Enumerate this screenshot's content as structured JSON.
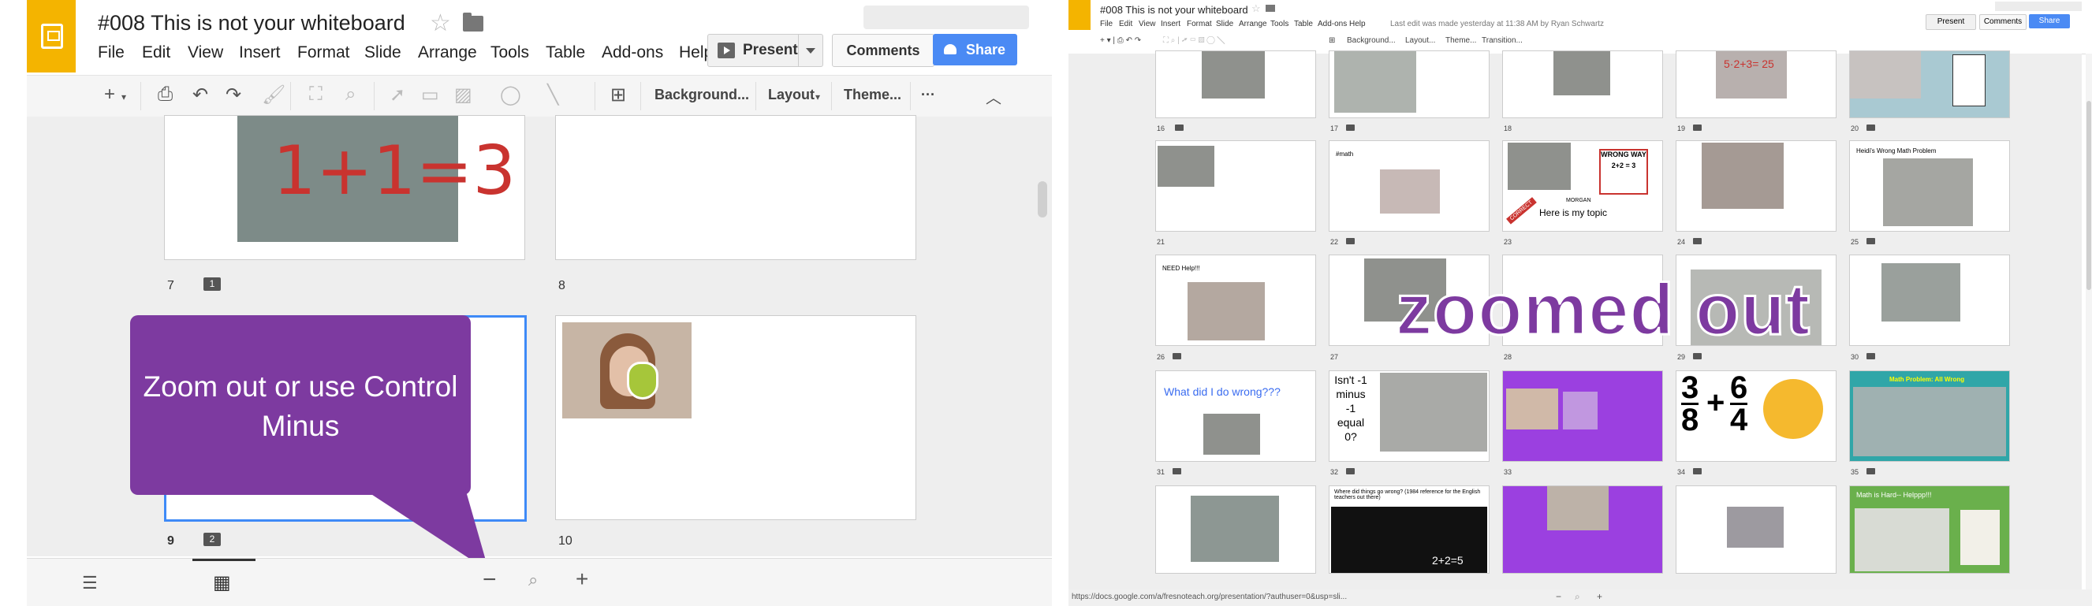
{
  "left": {
    "doc_title": "#008 This is not your whiteboard",
    "menu": [
      "File",
      "Edit",
      "View",
      "Insert",
      "Format",
      "Slide",
      "Arrange",
      "Tools",
      "Table",
      "Add-ons",
      "Help"
    ],
    "present_label": "Present",
    "comments_label": "Comments",
    "share_label": "Share",
    "toolbar": {
      "background": "Background...",
      "layout": "Layout",
      "theme": "Theme...",
      "more": "···"
    },
    "slides": {
      "s7_equation": "1+1=3",
      "s7_number": "7",
      "s7_comments": "1",
      "s8_number": "8",
      "s9_number": "9",
      "s9_comments": "2",
      "s10_number": "10"
    },
    "callout_text": "Zoom out or use Control Minus",
    "zoom_minus": "−",
    "zoom_plus": "+",
    "accent": "#7d3aa0",
    "share_color": "#4a8af4",
    "brand_color": "#f4b400"
  },
  "right": {
    "doc_title": "#008 This is not your whiteboard",
    "menu": [
      "File",
      "Edit",
      "View",
      "Insert",
      "Format",
      "Slide",
      "Arrange",
      "Tools",
      "Table",
      "Add-ons",
      "Help"
    ],
    "last_edit": "Last edit was made yesterday at 11:38 AM by Ryan Schwartz",
    "present_label": "Present",
    "comments_label": "Comments",
    "share_label": "Share",
    "toolbar": {
      "background": "Background...",
      "layout": "Layout...",
      "theme": "Theme...",
      "transition": "Transition..."
    },
    "overlay_text": "zoomed out",
    "row1_numbers": [
      "16",
      "17",
      "18",
      "19",
      "20"
    ],
    "row2_numbers": [
      "21",
      "22",
      "23",
      "24",
      "25"
    ],
    "row3_numbers": [
      "26",
      "27",
      "28",
      "29",
      "30"
    ],
    "row4_numbers": [
      "31",
      "32",
      "33",
      "34",
      "35"
    ],
    "slide_texts": {
      "s19": "5·2+3= 25",
      "s22": "#math",
      "s23_wrong": "WRONG WAY",
      "s23_eq": "2+2 = 3",
      "s23_correct": "CORRECT",
      "s23_name": "MORGAN",
      "s23_topic": "Here is my topic",
      "s25": "Heidi's Wrong Math Problem",
      "s26": "NEED Help!!!",
      "s31": "What did I do wrong???",
      "s32": "Isn't -1 minus -1 equal 0?",
      "s34_frac1_num": "3",
      "s34_frac1_den": "8",
      "s34_plus": "+",
      "s34_frac2_num": "6",
      "s34_frac2_den": "4",
      "s35": "Math Problem: All Wrong",
      "s37": "Where did things go wrong? (1984 reference for the English teachers out there)",
      "s37_eq": "2+2=5",
      "s40": "Math is Hard-- Helppp!!!"
    },
    "status_url": "https://docs.google.com/a/fresnoteach.org/presentation/?authuser=0&usp=sli..."
  }
}
